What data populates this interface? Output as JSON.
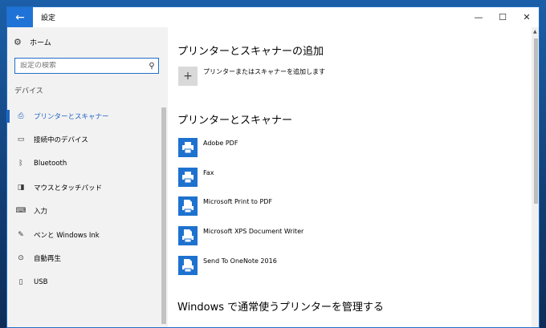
{
  "window": {
    "title": "設定"
  },
  "titlebar": {
    "back_icon": "←",
    "minimize": "—",
    "maximize": "☐",
    "close": "✕"
  },
  "sidebar": {
    "home_label": "ホーム",
    "search_placeholder": "設定の検索",
    "section_label": "デバイス",
    "items": [
      {
        "label": "プリンターとスキャナー",
        "icon": "printer-icon",
        "glyph": "⎙",
        "active": true
      },
      {
        "label": "接続中のデバイス",
        "icon": "devices-icon",
        "glyph": "▭",
        "active": false
      },
      {
        "label": "Bluetooth",
        "icon": "bluetooth-icon",
        "glyph": "ᛒ",
        "active": false
      },
      {
        "label": "マウスとタッチパッド",
        "icon": "mouse-icon",
        "glyph": "◨",
        "active": false
      },
      {
        "label": "入力",
        "icon": "keyboard-icon",
        "glyph": "⌨",
        "active": false
      },
      {
        "label": "ペンと Windows Ink",
        "icon": "pen-icon",
        "glyph": "✎",
        "active": false
      },
      {
        "label": "自動再生",
        "icon": "autoplay-icon",
        "glyph": "⊙",
        "active": false
      },
      {
        "label": "USB",
        "icon": "usb-icon",
        "glyph": "▯",
        "active": false
      }
    ]
  },
  "main": {
    "add_section_title": "プリンターとスキャナーの追加",
    "add_button_label": "プリンターまたはスキャナーを追加します",
    "list_section_title": "プリンターとスキャナー",
    "printers": [
      {
        "name": "Adobe PDF",
        "icon": "printer-icon"
      },
      {
        "name": "Fax",
        "icon": "printer-icon"
      },
      {
        "name": "Microsoft Print to PDF",
        "icon": "document-printer-icon"
      },
      {
        "name": "Microsoft XPS Document Writer",
        "icon": "document-printer-icon"
      },
      {
        "name": "Send To OneNote 2016",
        "icon": "document-printer-icon"
      }
    ],
    "manage_section_title": "Windows で通常使うプリンターを管理する"
  },
  "colors": {
    "accent": "#1f73d6",
    "sidebar_bg": "#f2f2f2",
    "printer_tile": "#1e72cf"
  }
}
